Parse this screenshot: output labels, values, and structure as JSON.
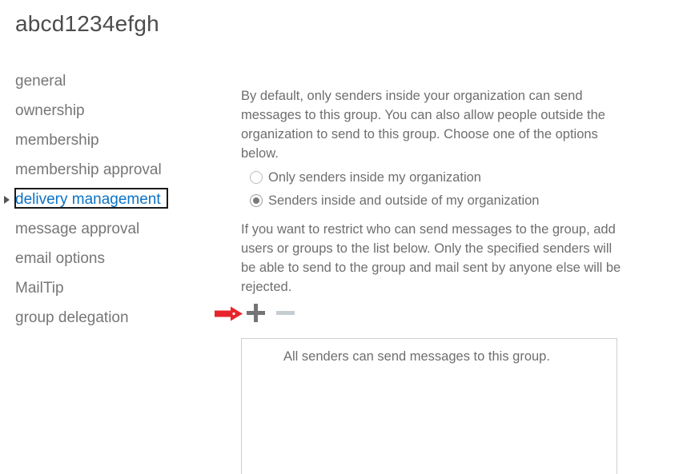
{
  "header": {
    "title": "abcd1234efgh"
  },
  "sidebar": {
    "items": [
      {
        "label": "general",
        "selected": false
      },
      {
        "label": "ownership",
        "selected": false
      },
      {
        "label": "membership",
        "selected": false
      },
      {
        "label": "membership approval",
        "selected": false
      },
      {
        "label": "delivery management",
        "selected": true
      },
      {
        "label": "message approval",
        "selected": false
      },
      {
        "label": "email options",
        "selected": false
      },
      {
        "label": "MailTip",
        "selected": false
      },
      {
        "label": "group delegation",
        "selected": false
      }
    ],
    "selected_index": 4,
    "selected_color": "#0b72c4",
    "text_color": "#767676"
  },
  "main": {
    "intro_paragraph": "By default, only senders inside your organization can send messages to this group. You can also allow people outside the organization to send to this group. Choose one of the options below.",
    "radio_group": {
      "options": [
        {
          "label": "Only senders inside my organization",
          "checked": false
        },
        {
          "label": "Senders inside and outside of my organization",
          "checked": true
        }
      ],
      "selected_index": 1
    },
    "restrict_paragraph": "If you want to restrict who can send messages to the group, add users or groups to the list below. Only the specified senders will be able to send to the group and mail sent by anyone else will be rejected.",
    "toolbar": {
      "add_label": "+",
      "add_icon": "plus-icon",
      "remove_label": "−",
      "remove_icon": "minus-icon",
      "add_enabled": true,
      "remove_enabled": false
    },
    "listbox": {
      "empty_text": "All senders can send messages to this group.",
      "border_color": "#c9d0d5"
    },
    "annotation": {
      "icon": "red-arrow-icon",
      "color": "#e8242a",
      "points_at": "add-button"
    }
  }
}
